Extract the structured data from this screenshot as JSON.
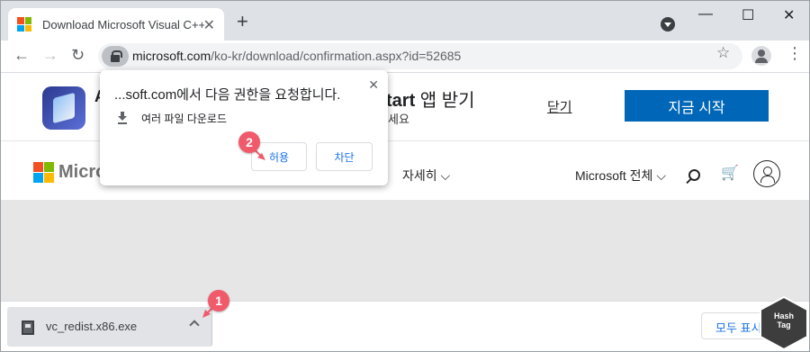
{
  "browser": {
    "tab_title": "Download Microsoft Visual C++",
    "tab_close": "✕",
    "new_tab": "+",
    "url_domain": "microsoft.com",
    "url_path": "/ko-kr/download/confirmation.aspx?id=52685",
    "window_controls": [
      "—",
      "☐",
      "✕"
    ],
    "nav": {
      "back": "←",
      "forward": "→",
      "reload": "↻"
    },
    "star": "☆",
    "menu": "⋮"
  },
  "banner": {
    "letter": "A",
    "title_prefix": "tart",
    "title_suffix": " 앱 받기",
    "subtitle": "세요",
    "close_link": "닫기",
    "start_button": "지금 시작"
  },
  "msnav": {
    "brand": "Microsoft",
    "more": "자세히 ⌵",
    "all_ms": "Microsoft 전체 ⌵",
    "cart": "🛒"
  },
  "popup": {
    "title": "...soft.com에서 다음 권한을 요청합니다.",
    "close": "✕",
    "permission": "여러 파일 다운로드",
    "allow_label": "허용",
    "block_label": "차단"
  },
  "badges": {
    "one": "1",
    "two": "2"
  },
  "download_bar": {
    "file_name": "vc_redist.x86.exe",
    "show_all": "모두 표시"
  },
  "watermark": {
    "line1": "Hash",
    "line2": "Tag"
  },
  "colors": {
    "ms_red": "#f25022",
    "ms_green": "#7fba00",
    "ms_blue": "#00a4ef",
    "ms_yellow": "#ffb900",
    "accent": "#0067b8",
    "badge": "#f05a6b"
  }
}
